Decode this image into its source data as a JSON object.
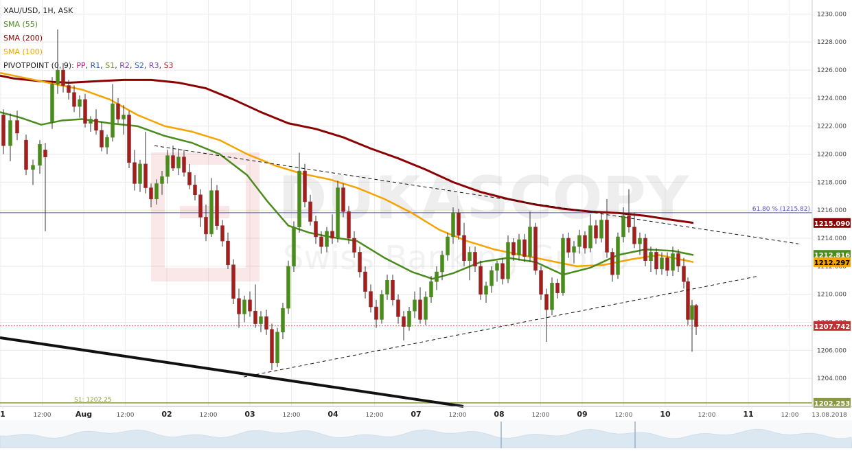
{
  "chart_data": {
    "type": "candlestick",
    "symbol_line": "XAU/USD, 1H, ASK",
    "watermark": {
      "brand": "DUKASCOPY",
      "tagline": "Swiss Banking Group"
    },
    "y_axis": {
      "ylim": [
        1202.0,
        1231.0
      ],
      "ticks": [
        "1204.000",
        "1206.000",
        "1208.000",
        "1210.000",
        "1212.000",
        "1214.000",
        "1216.000",
        "1218.000",
        "1220.000",
        "1222.000",
        "1224.000",
        "1226.000",
        "1228.000",
        "1230.000"
      ],
      "tick_values": [
        1204,
        1206,
        1208,
        1210,
        1212,
        1214,
        1216,
        1218,
        1220,
        1222,
        1224,
        1226,
        1228,
        1230
      ]
    },
    "x_axis": {
      "labels": [
        "1",
        "12:00",
        "Aug",
        "12:00",
        "02",
        "12:00",
        "03",
        "12:00",
        "04",
        "12:00",
        "07",
        "12:00",
        "08",
        "12:00",
        "09",
        "12:00",
        "10",
        "12:00",
        "11",
        "12:00",
        "13.08.2018"
      ],
      "bold": [
        true,
        false,
        true,
        false,
        true,
        false,
        true,
        false,
        true,
        false,
        true,
        false,
        true,
        false,
        true,
        false,
        true,
        false,
        true,
        false,
        false
      ]
    },
    "legend": {
      "sma55": {
        "label": "SMA (55)",
        "color": "#4a8c1c"
      },
      "sma200": {
        "label": "SMA (200)",
        "color": "#8b0000"
      },
      "sma100": {
        "label": "SMA (100)",
        "color": "#f5a300"
      },
      "pivot": {
        "prefix": "PIVOTPOINT (0, 9):",
        "items": [
          {
            "label": "PP",
            "color": "#e0007a"
          },
          {
            "label": "R1",
            "color": "#3355cc"
          },
          {
            "label": "S1",
            "color": "#6b8e23"
          },
          {
            "label": "R2",
            "color": "#7a3fbf"
          },
          {
            "label": "S2",
            "color": "#3366bb"
          },
          {
            "label": "R3",
            "color": "#7a3fbf"
          },
          {
            "label": "S3",
            "color": "#a52a2a"
          }
        ]
      }
    },
    "fib_level": {
      "label": "61.80 % (1215.82)",
      "value": 1215.82,
      "color": "#5050d0"
    },
    "s1_level": {
      "label": "S1: 1202.25",
      "value": 1202.25,
      "color": "#8a9a3a"
    },
    "price_tags": [
      {
        "text": "1215.090",
        "value": 1215.09,
        "bg": "#8b0000",
        "fg": "#ffffff"
      },
      {
        "text": "1212.816",
        "value": 1212.816,
        "bg": "#4a8c1c",
        "fg": "#ffffff"
      },
      {
        "text": "1212.297",
        "value": 1212.297,
        "bg": "#f5a300",
        "fg": "#000000"
      },
      {
        "text": "1207.742",
        "value": 1207.742,
        "bg": "#c03030",
        "fg": "#ffffff"
      },
      {
        "text": "1202.253",
        "value": 1202.253,
        "bg": "#8a9a3a",
        "fg": "#ffffff"
      }
    ],
    "current_price": 1207.742,
    "sma200": [
      [
        0,
        1225.6
      ],
      [
        20,
        1225.4
      ],
      [
        60,
        1225.2
      ],
      [
        100,
        1225.1
      ],
      [
        140,
        1225.2
      ],
      [
        180,
        1225.3
      ],
      [
        220,
        1225.3
      ],
      [
        260,
        1225.1
      ],
      [
        300,
        1224.7
      ],
      [
        340,
        1223.9
      ],
      [
        380,
        1223.0
      ],
      [
        420,
        1222.2
      ],
      [
        460,
        1221.8
      ],
      [
        500,
        1221.2
      ],
      [
        540,
        1220.4
      ],
      [
        580,
        1219.7
      ],
      [
        620,
        1218.9
      ],
      [
        660,
        1218.0
      ],
      [
        700,
        1217.3
      ],
      [
        740,
        1216.8
      ],
      [
        780,
        1216.4
      ],
      [
        820,
        1216.1
      ],
      [
        860,
        1215.9
      ],
      [
        900,
        1215.8
      ],
      [
        940,
        1215.6
      ],
      [
        980,
        1215.3
      ],
      [
        1010,
        1215.1
      ]
    ],
    "sma100": [
      [
        0,
        1225.8
      ],
      [
        40,
        1225.4
      ],
      [
        80,
        1225.0
      ],
      [
        120,
        1224.6
      ],
      [
        160,
        1223.9
      ],
      [
        200,
        1222.8
      ],
      [
        240,
        1222.0
      ],
      [
        280,
        1221.6
      ],
      [
        320,
        1221.0
      ],
      [
        360,
        1220.0
      ],
      [
        400,
        1219.2
      ],
      [
        440,
        1218.6
      ],
      [
        480,
        1218.2
      ],
      [
        520,
        1217.6
      ],
      [
        560,
        1216.8
      ],
      [
        600,
        1215.8
      ],
      [
        640,
        1214.6
      ],
      [
        680,
        1213.8
      ],
      [
        720,
        1213.2
      ],
      [
        760,
        1212.8
      ],
      [
        800,
        1212.4
      ],
      [
        840,
        1212.0
      ],
      [
        880,
        1212.1
      ],
      [
        920,
        1212.5
      ],
      [
        960,
        1212.8
      ],
      [
        980,
        1212.6
      ],
      [
        1010,
        1212.3
      ]
    ],
    "sma55": [
      [
        0,
        1223.0
      ],
      [
        30,
        1222.6
      ],
      [
        60,
        1222.1
      ],
      [
        90,
        1222.4
      ],
      [
        120,
        1222.5
      ],
      [
        160,
        1222.2
      ],
      [
        200,
        1222.0
      ],
      [
        240,
        1221.3
      ],
      [
        280,
        1220.8
      ],
      [
        320,
        1220.0
      ],
      [
        360,
        1218.5
      ],
      [
        390,
        1216.6
      ],
      [
        420,
        1214.9
      ],
      [
        450,
        1214.4
      ],
      [
        480,
        1214.1
      ],
      [
        520,
        1213.8
      ],
      [
        560,
        1212.6
      ],
      [
        600,
        1211.6
      ],
      [
        630,
        1211.1
      ],
      [
        660,
        1211.5
      ],
      [
        700,
        1212.3
      ],
      [
        740,
        1212.6
      ],
      [
        780,
        1212.3
      ],
      [
        820,
        1211.4
      ],
      [
        860,
        1211.9
      ],
      [
        900,
        1212.8
      ],
      [
        940,
        1213.2
      ],
      [
        980,
        1213.1
      ],
      [
        1010,
        1212.8
      ]
    ],
    "candles": [
      [
        5,
        1222.8,
        1223.2,
        1220.0,
        1220.6
      ],
      [
        15,
        1220.6,
        1222.9,
        1219.5,
        1222.4
      ],
      [
        25,
        1222.4,
        1223.1,
        1221.0,
        1221.5
      ],
      [
        38,
        1221.0,
        1221.4,
        1218.5,
        1218.9
      ],
      [
        48,
        1218.9,
        1219.6,
        1217.8,
        1219.2
      ],
      [
        58,
        1219.2,
        1221.0,
        1218.6,
        1220.7
      ],
      [
        66,
        1220.3,
        1220.8,
        1214.5,
        1219.8
      ],
      [
        76,
        1222.3,
        1225.5,
        1221.8,
        1225.0
      ],
      [
        84,
        1225.0,
        1228.9,
        1224.3,
        1226.0
      ],
      [
        92,
        1226.0,
        1226.5,
        1224.4,
        1224.9
      ],
      [
        100,
        1224.9,
        1225.3,
        1223.9,
        1224.4
      ],
      [
        108,
        1224.4,
        1224.9,
        1223.0,
        1223.4
      ],
      [
        116,
        1223.4,
        1224.2,
        1222.6,
        1223.9
      ],
      [
        124,
        1223.9,
        1224.3,
        1221.9,
        1222.2
      ],
      [
        132,
        1222.2,
        1222.7,
        1221.6,
        1222.5
      ],
      [
        140,
        1222.5,
        1223.2,
        1221.4,
        1221.7
      ],
      [
        148,
        1221.7,
        1222.3,
        1220.2,
        1220.5
      ],
      [
        156,
        1220.5,
        1221.4,
        1220.0,
        1221.2
      ],
      [
        164,
        1221.2,
        1225.0,
        1220.9,
        1223.6
      ],
      [
        172,
        1223.6,
        1224.0,
        1222.2,
        1222.5
      ],
      [
        180,
        1222.5,
        1223.5,
        1221.4,
        1222.8
      ],
      [
        188,
        1222.8,
        1223.1,
        1219.0,
        1219.4
      ],
      [
        196,
        1219.4,
        1220.3,
        1217.4,
        1217.9
      ],
      [
        204,
        1217.9,
        1219.6,
        1217.3,
        1219.3
      ],
      [
        212,
        1219.3,
        1221.6,
        1217.2,
        1217.6
      ],
      [
        220,
        1217.6,
        1217.9,
        1216.2,
        1216.8
      ],
      [
        228,
        1216.8,
        1218.2,
        1216.4,
        1217.9
      ],
      [
        236,
        1217.9,
        1218.8,
        1217.1,
        1218.4
      ],
      [
        244,
        1218.4,
        1220.3,
        1217.9,
        1219.9
      ],
      [
        252,
        1219.9,
        1220.6,
        1218.8,
        1219.0
      ],
      [
        260,
        1219.0,
        1220.4,
        1218.5,
        1219.8
      ],
      [
        268,
        1219.8,
        1220.3,
        1218.4,
        1218.7
      ],
      [
        276,
        1218.7,
        1219.3,
        1217.5,
        1217.8
      ],
      [
        284,
        1217.8,
        1218.5,
        1216.7,
        1217.1
      ],
      [
        292,
        1217.1,
        1217.5,
        1214.8,
        1215.5
      ],
      [
        300,
        1215.5,
        1216.4,
        1213.8,
        1214.3
      ],
      [
        308,
        1214.3,
        1218.3,
        1214.1,
        1217.4
      ],
      [
        316,
        1217.4,
        1217.8,
        1214.6,
        1214.9
      ],
      [
        324,
        1214.9,
        1215.3,
        1213.4,
        1213.8
      ],
      [
        332,
        1213.8,
        1214.4,
        1211.8,
        1212.1
      ],
      [
        340,
        1212.1,
        1212.5,
        1209.3,
        1209.7
      ],
      [
        348,
        1209.7,
        1210.4,
        1207.6,
        1208.6
      ],
      [
        356,
        1208.6,
        1209.9,
        1208.0,
        1209.6
      ],
      [
        364,
        1209.6,
        1210.2,
        1208.4,
        1208.8
      ],
      [
        372,
        1208.8,
        1210.7,
        1207.6,
        1207.9
      ],
      [
        380,
        1207.9,
        1208.8,
        1207.3,
        1208.4
      ],
      [
        388,
        1208.4,
        1208.9,
        1207.1,
        1207.5
      ],
      [
        396,
        1207.5,
        1207.9,
        1204.6,
        1205.1
      ],
      [
        404,
        1205.1,
        1207.6,
        1204.8,
        1207.3
      ],
      [
        412,
        1207.3,
        1209.4,
        1206.8,
        1209.0
      ],
      [
        420,
        1209.0,
        1212.4,
        1208.6,
        1212.0
      ],
      [
        428,
        1212.0,
        1215.2,
        1211.6,
        1214.8
      ],
      [
        436,
        1214.8,
        1220.1,
        1214.4,
        1218.8
      ],
      [
        444,
        1218.8,
        1219.3,
        1216.2,
        1216.6
      ],
      [
        452,
        1216.6,
        1217.1,
        1214.9,
        1215.2
      ],
      [
        460,
        1215.2,
        1215.6,
        1213.6,
        1214.1
      ],
      [
        468,
        1214.1,
        1214.5,
        1212.9,
        1213.4
      ],
      [
        476,
        1213.4,
        1214.8,
        1213.0,
        1214.5
      ],
      [
        484,
        1214.5,
        1215.7,
        1213.6,
        1214.0
      ],
      [
        492,
        1214.0,
        1218.1,
        1213.7,
        1217.6
      ],
      [
        500,
        1217.6,
        1217.9,
        1215.5,
        1215.9
      ],
      [
        508,
        1215.9,
        1216.3,
        1213.6,
        1214.0
      ],
      [
        516,
        1214.0,
        1214.5,
        1212.6,
        1213.0
      ],
      [
        524,
        1213.0,
        1213.4,
        1211.2,
        1211.6
      ],
      [
        532,
        1211.6,
        1212.0,
        1209.7,
        1210.2
      ],
      [
        540,
        1210.2,
        1210.7,
        1208.7,
        1209.1
      ],
      [
        548,
        1209.1,
        1209.6,
        1207.6,
        1208.2
      ],
      [
        556,
        1208.2,
        1210.3,
        1207.9,
        1210.0
      ],
      [
        564,
        1210.0,
        1211.4,
        1209.6,
        1211.0
      ],
      [
        572,
        1211.0,
        1211.4,
        1209.2,
        1209.6
      ],
      [
        580,
        1209.6,
        1210.0,
        1207.9,
        1208.4
      ],
      [
        588,
        1208.4,
        1208.8,
        1206.7,
        1207.7
      ],
      [
        596,
        1207.7,
        1209.1,
        1207.4,
        1208.8
      ],
      [
        604,
        1208.8,
        1210.2,
        1208.3,
        1209.6
      ],
      [
        612,
        1209.6,
        1210.5,
        1207.9,
        1208.2
      ],
      [
        620,
        1208.2,
        1210.2,
        1207.8,
        1209.8
      ],
      [
        628,
        1209.8,
        1211.3,
        1209.4,
        1210.9
      ],
      [
        636,
        1210.9,
        1212.0,
        1210.3,
        1211.6
      ],
      [
        644,
        1211.6,
        1213.1,
        1211.0,
        1212.8
      ],
      [
        652,
        1212.8,
        1214.4,
        1212.4,
        1214.1
      ],
      [
        660,
        1214.1,
        1216.2,
        1213.6,
        1215.8
      ],
      [
        668,
        1215.8,
        1216.1,
        1213.9,
        1214.2
      ],
      [
        676,
        1214.2,
        1215.1,
        1212.0,
        1212.4
      ],
      [
        684,
        1212.4,
        1213.4,
        1211.0,
        1213.0
      ],
      [
        692,
        1213.0,
        1213.4,
        1211.6,
        1212.0
      ],
      [
        700,
        1212.0,
        1212.4,
        1209.6,
        1210.0
      ],
      [
        708,
        1210.0,
        1210.9,
        1209.4,
        1210.6
      ],
      [
        716,
        1210.6,
        1212.0,
        1210.1,
        1211.7
      ],
      [
        724,
        1211.7,
        1212.4,
        1210.9,
        1212.2
      ],
      [
        732,
        1212.2,
        1212.6,
        1210.7,
        1211.1
      ],
      [
        740,
        1211.1,
        1214.2,
        1210.8,
        1213.7
      ],
      [
        748,
        1213.7,
        1214.0,
        1212.4,
        1212.8
      ],
      [
        756,
        1212.8,
        1214.3,
        1212.4,
        1213.9
      ],
      [
        764,
        1213.9,
        1214.3,
        1212.3,
        1212.7
      ],
      [
        772,
        1212.7,
        1215.9,
        1212.3,
        1214.8
      ],
      [
        780,
        1214.8,
        1215.1,
        1211.4,
        1211.7
      ],
      [
        788,
        1211.7,
        1212.0,
        1209.6,
        1210.0
      ],
      [
        796,
        1210.0,
        1210.4,
        1206.6,
        1208.9
      ],
      [
        804,
        1208.9,
        1211.2,
        1208.5,
        1210.8
      ],
      [
        812,
        1210.8,
        1211.1,
        1209.7,
        1210.1
      ],
      [
        820,
        1210.1,
        1214.3,
        1209.9,
        1214.0
      ],
      [
        828,
        1214.0,
        1214.4,
        1212.6,
        1213.0
      ],
      [
        836,
        1213.0,
        1213.8,
        1212.2,
        1213.4
      ],
      [
        844,
        1213.4,
        1214.6,
        1212.9,
        1214.2
      ],
      [
        852,
        1214.2,
        1214.5,
        1212.9,
        1213.3
      ],
      [
        860,
        1213.3,
        1215.7,
        1213.0,
        1214.9
      ],
      [
        868,
        1214.9,
        1215.3,
        1213.6,
        1214.0
      ],
      [
        876,
        1214.0,
        1215.9,
        1213.7,
        1215.3
      ],
      [
        884,
        1215.3,
        1216.8,
        1212.6,
        1213.0
      ],
      [
        892,
        1213.0,
        1213.3,
        1210.9,
        1211.4
      ],
      [
        900,
        1211.4,
        1214.4,
        1211.1,
        1214.1
      ],
      [
        908,
        1214.1,
        1216.2,
        1213.7,
        1215.6
      ],
      [
        916,
        1215.6,
        1217.5,
        1214.4,
        1214.8
      ],
      [
        924,
        1214.8,
        1215.8,
        1213.3,
        1213.6
      ],
      [
        932,
        1213.6,
        1214.4,
        1212.8,
        1214.0
      ],
      [
        940,
        1214.0,
        1214.3,
        1212.0,
        1212.4
      ],
      [
        948,
        1212.4,
        1213.4,
        1211.6,
        1213.0
      ],
      [
        956,
        1213.0,
        1213.3,
        1211.4,
        1211.8
      ],
      [
        964,
        1211.8,
        1213.0,
        1211.4,
        1212.6
      ],
      [
        972,
        1212.6,
        1213.0,
        1211.3,
        1211.7
      ],
      [
        980,
        1211.7,
        1213.4,
        1211.3,
        1212.9
      ],
      [
        988,
        1212.9,
        1213.2,
        1211.6,
        1212.0
      ],
      [
        996,
        1212.0,
        1212.6,
        1210.4,
        1210.9
      ],
      [
        1002,
        1210.9,
        1211.2,
        1207.8,
        1208.2
      ],
      [
        1008,
        1208.2,
        1209.6,
        1205.9,
        1209.2
      ],
      [
        1014,
        1209.2,
        1209.3,
        1207.1,
        1207.7
      ]
    ],
    "trendlines": [
      {
        "from": [
          225,
          1220.6
        ],
        "to": [
          1163,
          1213.6
        ],
        "style": "dashed"
      },
      {
        "from": [
          355,
          1204.1
        ],
        "to": [
          1105,
          1211.3
        ],
        "style": "dashed"
      },
      {
        "from": [
          0,
          1206.9
        ],
        "to": [
          675,
          1202.0
        ],
        "style": "solid-thick"
      }
    ],
    "volume_spikes": [
      730,
      925
    ]
  }
}
